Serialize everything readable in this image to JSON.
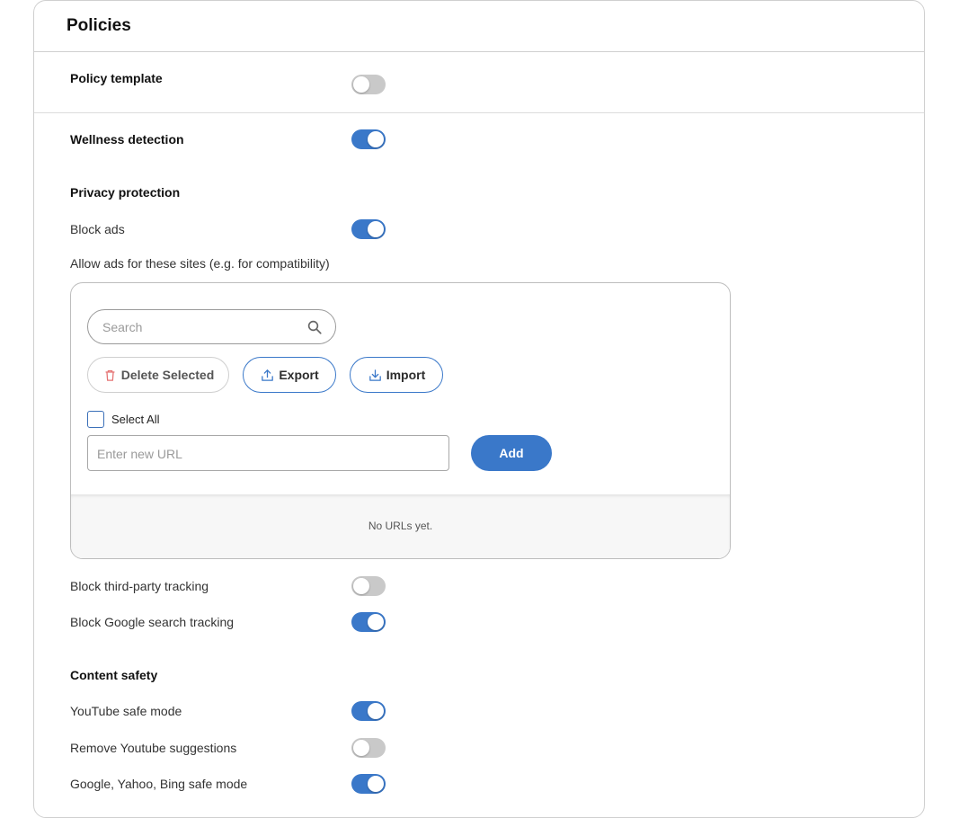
{
  "card": {
    "title": "Policies"
  },
  "policy_template": {
    "label": "Policy template",
    "enabled": false
  },
  "wellness_detection": {
    "label": "Wellness detection",
    "enabled": true
  },
  "privacy": {
    "heading": "Privacy protection",
    "block_ads": {
      "label": "Block ads",
      "enabled": true
    },
    "allow_ads_label": "Allow ads for these sites (e.g. for compatibility)",
    "url_list": {
      "search_placeholder": "Search",
      "delete_label": "Delete Selected",
      "export_label": "Export",
      "import_label": "Import",
      "select_all_label": "Select All",
      "select_all_checked": false,
      "new_url_placeholder": "Enter new URL",
      "add_label": "Add",
      "empty_text": "No URLs yet."
    },
    "block_third_party": {
      "label": "Block third-party tracking",
      "enabled": false
    },
    "block_google_tracking": {
      "label": "Block Google search tracking",
      "enabled": true
    }
  },
  "content_safety": {
    "heading": "Content safety",
    "youtube_safe": {
      "label": "YouTube safe mode",
      "enabled": true
    },
    "remove_youtube_suggestions": {
      "label": "Remove Youtube suggestions",
      "enabled": false
    },
    "search_safe_mode": {
      "label": "Google, Yahoo, Bing safe mode",
      "enabled": true
    }
  },
  "colors": {
    "accent": "#3a78c9",
    "toggle_off": "#c9c9c9",
    "delete_icon": "#e57373"
  },
  "icons": {
    "search": "search-icon",
    "delete": "trash-icon",
    "export": "upload-icon",
    "import": "download-icon"
  }
}
